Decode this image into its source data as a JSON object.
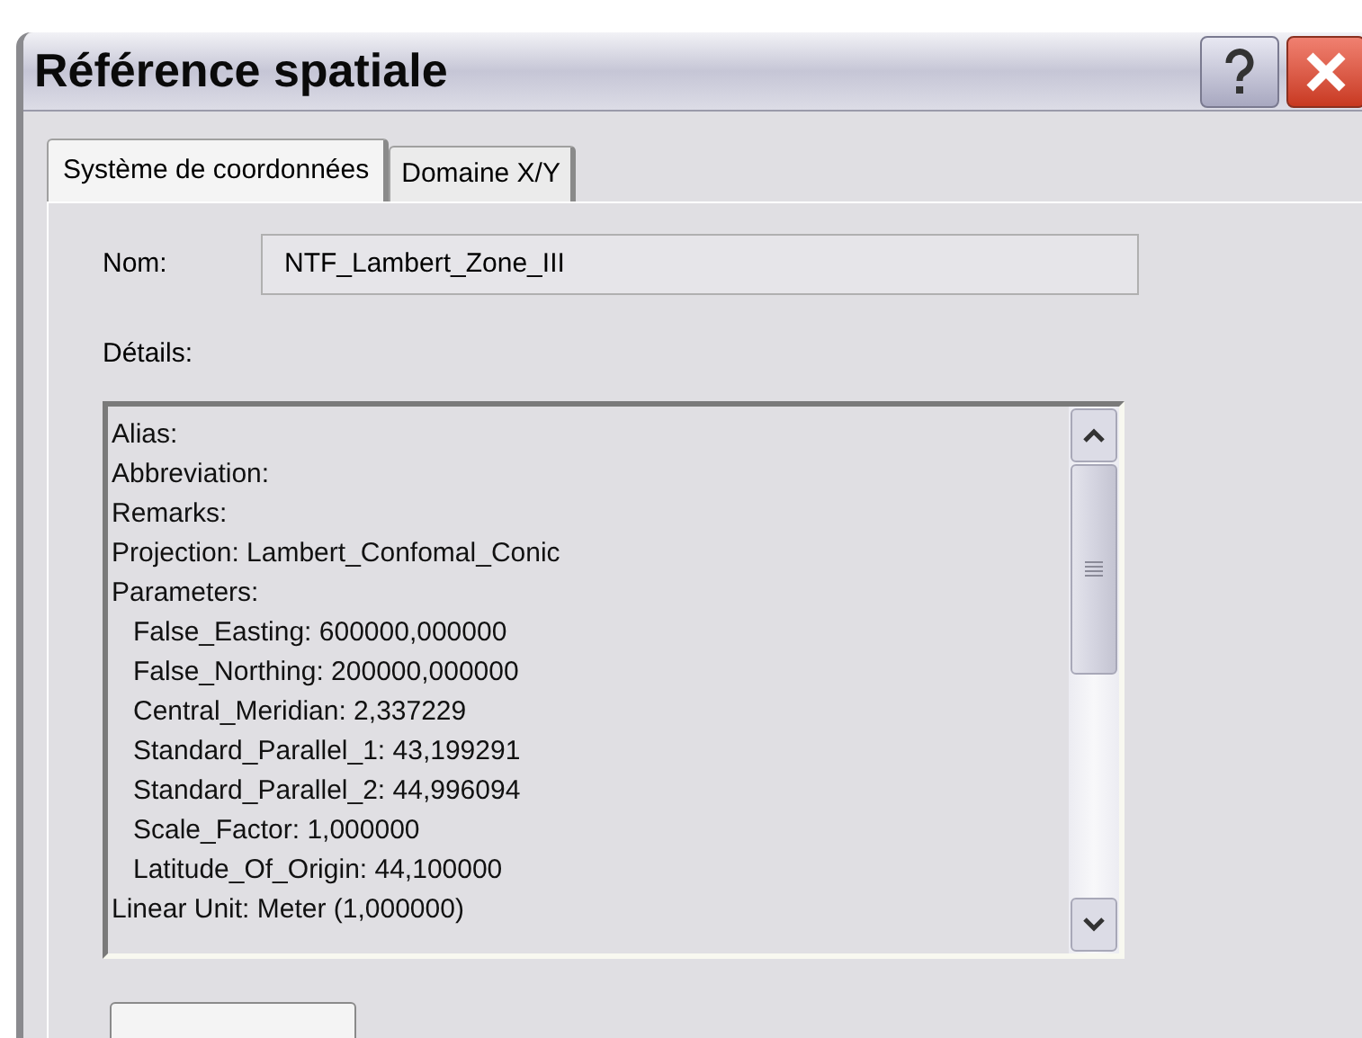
{
  "window": {
    "title": "Référence spatiale"
  },
  "tabs": [
    {
      "label": "Système de coordonnées",
      "selected": true
    },
    {
      "label": "Domaine X/Y",
      "selected": false
    }
  ],
  "name_field": {
    "label": "Nom:",
    "value": "NTF_Lambert_Zone_III"
  },
  "details": {
    "label": "Détails:",
    "lines": [
      {
        "text": "Alias:"
      },
      {
        "text": "Abbreviation:"
      },
      {
        "text": "Remarks:"
      },
      {
        "text": "Projection: Lambert_Confomal_Conic"
      },
      {
        "text": "Parameters:",
        "children": [
          {
            "text": "False_Easting: 600000,000000"
          },
          {
            "text": "False_Northing: 200000,000000"
          },
          {
            "text": "Central_Meridian: 2,337229"
          },
          {
            "text": "Standard_Parallel_1: 43,199291"
          },
          {
            "text": "Standard_Parallel_2: 44,996094"
          },
          {
            "text": "Scale_Factor: 1,000000"
          },
          {
            "text": "Latitude_Of_Origin: 44,100000"
          }
        ]
      },
      {
        "text": "Linear Unit: Meter (1,000000)"
      }
    ]
  }
}
